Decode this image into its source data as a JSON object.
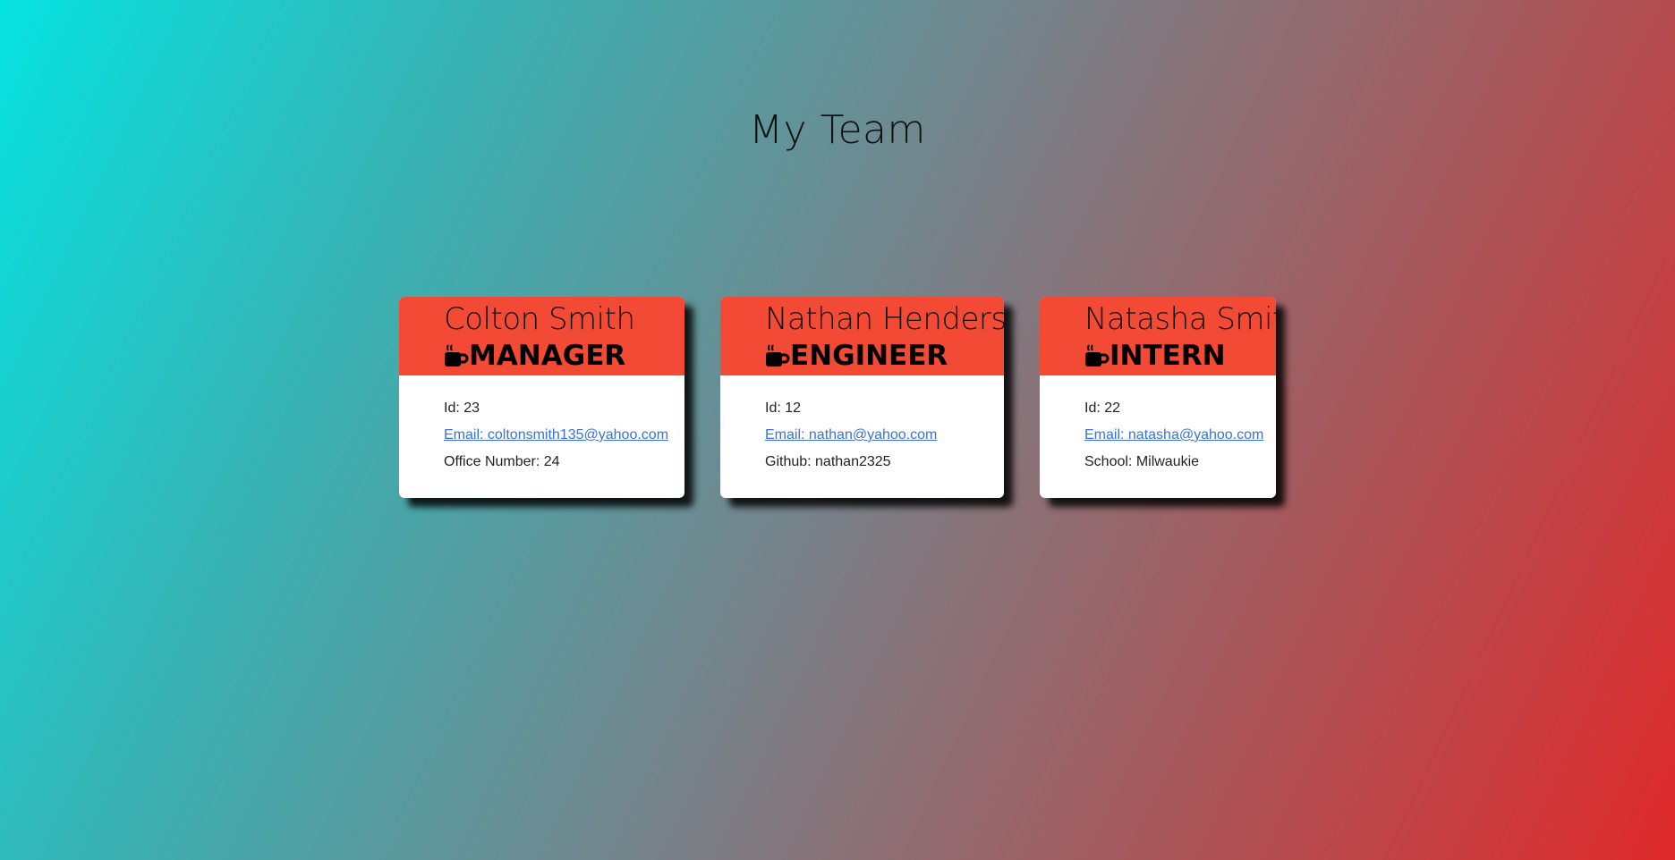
{
  "page": {
    "title": "My Team"
  },
  "colors": {
    "card_header": "#f24a35",
    "link": "#3b72d9"
  },
  "team": [
    {
      "name": "Colton Smith",
      "role": "Manager",
      "role_icon": "coffee-cup-icon",
      "id_text": "Id: 23",
      "email_text": "Email: coltonsmith135@yahoo.com",
      "extra_text": "Office Number: 24"
    },
    {
      "name": "Nathan Henderson",
      "role": "Engineer",
      "role_icon": "coffee-cup-icon",
      "id_text": "Id: 12",
      "email_text": "Email: nathan@yahoo.com",
      "extra_text": "Github: nathan2325"
    },
    {
      "name": "Natasha Smith",
      "role": "Intern",
      "role_icon": "coffee-cup-icon",
      "id_text": "Id: 22",
      "email_text": "Email: natasha@yahoo.com",
      "extra_text": "School: Milwaukie"
    }
  ]
}
